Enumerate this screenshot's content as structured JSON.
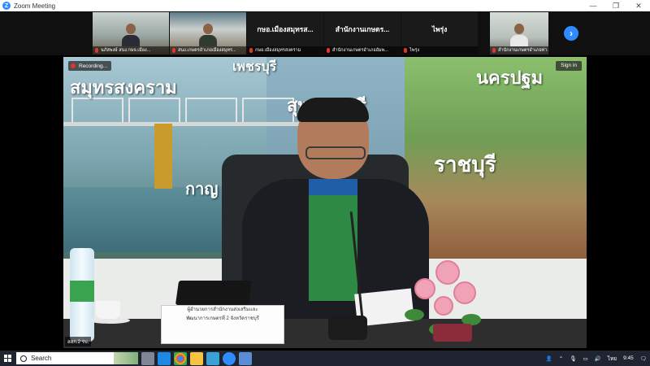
{
  "window": {
    "title": "Zoom Meeting",
    "logo_letter": "Z",
    "controls": [
      "—",
      "❐",
      "✕"
    ]
  },
  "participants": [
    {
      "name": "นภัสพงษ์ สนง.กษจ.เมือง...",
      "video": true
    },
    {
      "name": "สนง.เกษตรอำเภอเมืองสมุทร...",
      "video": true
    },
    {
      "name": "กษอ.เมืองสมุทรสงคราม",
      "display": "กษอ.เมืองสมุทรส...",
      "video": false
    },
    {
      "name": "สำนักงานเกษตรอำเภออัมพ...",
      "display": "สำนักงานเกษตร...",
      "video": false
    },
    {
      "name": "ไพรุ่ง",
      "display": "ไพรุ่ง",
      "video": false
    },
    {
      "name": "สำนักงานเกษตรอำเภอท่า...",
      "video": true
    }
  ],
  "strip_next_icon": "chevron-right-icon",
  "main_video": {
    "recording_label": "Recording...",
    "signin_label": "Sign in",
    "speaker_label": "สสก.2 รบ.",
    "backdrop_provinces": [
      "เพชรบุรี",
      "สมุทรสงคราม",
      "สุพรรณบุรี",
      "นครปฐม",
      "ราชบุรี",
      "กาญ"
    ],
    "nameplate": [
      "ผู้อำนวยการสำนักงานส่งเสริมและ",
      "พัฒนาการเกษตรที่ 2 จังหวัดราชบุรี"
    ]
  },
  "taskbar": {
    "search_placeholder": "Search",
    "apps": [
      "file-explorer-icon",
      "edge-icon",
      "chrome-icon",
      "folder-icon",
      "photos-icon",
      "zoom-icon",
      "screen-icon"
    ],
    "tray": {
      "language": "ไทย",
      "time": "9:45"
    }
  },
  "colors": {
    "zoom_blue": "#2d8cff",
    "taskbar": "#1f2430",
    "recording_red": "#e2352b"
  }
}
